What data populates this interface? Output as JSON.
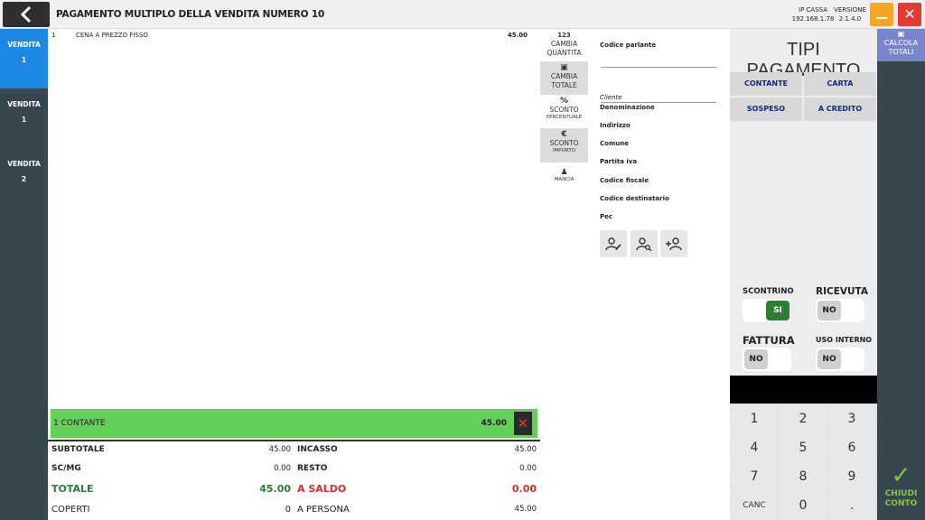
{
  "header": {
    "title": "PAGAMENTO MULTIPLO DELLA VENDITA NUMERO 10",
    "ip_label": "IP CASSA",
    "ip_value": "192.168.1.78",
    "version_label": "VERSIONE",
    "version_value": "2.1.4.0"
  },
  "sidebar": {
    "tabs": [
      {
        "label": "VENDITA",
        "number": "1",
        "active": true
      },
      {
        "label": "VENDITA",
        "number": "1",
        "active": false
      },
      {
        "label": "VENDITA",
        "number": "2",
        "active": false
      }
    ]
  },
  "items": [
    {
      "qty": "1",
      "name": "CENA A PREZZO FISSO",
      "price": "45.00"
    }
  ],
  "payment_line": {
    "label": "1 CONTANTE",
    "amount": "45.00"
  },
  "totals": {
    "subtotale_label": "SUBTOTALE",
    "subtotale": "45.00",
    "incasso_label": "INCASSO",
    "incasso": "45.00",
    "scmg_label": "SC/MG",
    "scmg": "0.00",
    "resto_label": "RESTO",
    "resto": "0.00",
    "totale_label": "TOTALE",
    "totale": "45.00",
    "saldo_label": "A SALDO",
    "saldo": "0.00",
    "coperti_label": "COPERTI",
    "coperti": "0",
    "persona_label": "A PERSONA",
    "persona": "45.00"
  },
  "actions": [
    {
      "icon": "123",
      "label1": "CAMBIA",
      "label2": "QUANTITA"
    },
    {
      "icon": "▣",
      "label1": "CAMBIA",
      "label2": "TOTALE"
    },
    {
      "icon": "%",
      "label1": "SCONTO",
      "sub": "PERCENTUALE"
    },
    {
      "icon": "€",
      "label1": "SCONTO",
      "sub": "IMPORTO"
    },
    {
      "icon": "♟",
      "sub": "MANCIA"
    }
  ],
  "customer": {
    "codice_parlante": "Codice parlante",
    "section": "Cliente",
    "fields": [
      "Denominazione",
      "Indirizzo",
      "Comune",
      "Partita iva",
      "Codice fiscale",
      "Codice destinatario",
      "Pec"
    ]
  },
  "payment_types": {
    "title": "TIPI PAGAMENTO",
    "buttons": [
      "CONTANTE",
      "CARTA",
      "SOSPESO",
      "A CREDITO"
    ]
  },
  "toggles": {
    "scontrino": {
      "label": "SCONTRINO",
      "value": "SI"
    },
    "ricevuta": {
      "label": "RICEVUTA",
      "value": "NO"
    },
    "fattura": {
      "label": "FATTURA",
      "value": "NO"
    },
    "uso_interno": {
      "label": "USO INTERNO",
      "value": "NO"
    }
  },
  "keypad": [
    "1",
    "2",
    "3",
    "4",
    "5",
    "6",
    "7",
    "8",
    "9",
    "CANC",
    "0",
    "."
  ],
  "right": {
    "calc_line1": "CALCOLA",
    "calc_line2": "TOTALI",
    "close_line1": "CHIUDI",
    "close_line2": "CONTO"
  },
  "colors": {
    "accent_blue": "#1e88e5",
    "sidebar": "#37474f",
    "payment_green": "#64d05a",
    "toggle_on": "#2e7d32",
    "calc_button": "#7986cb",
    "minimize": "#f5a623",
    "close": "#e53935"
  }
}
